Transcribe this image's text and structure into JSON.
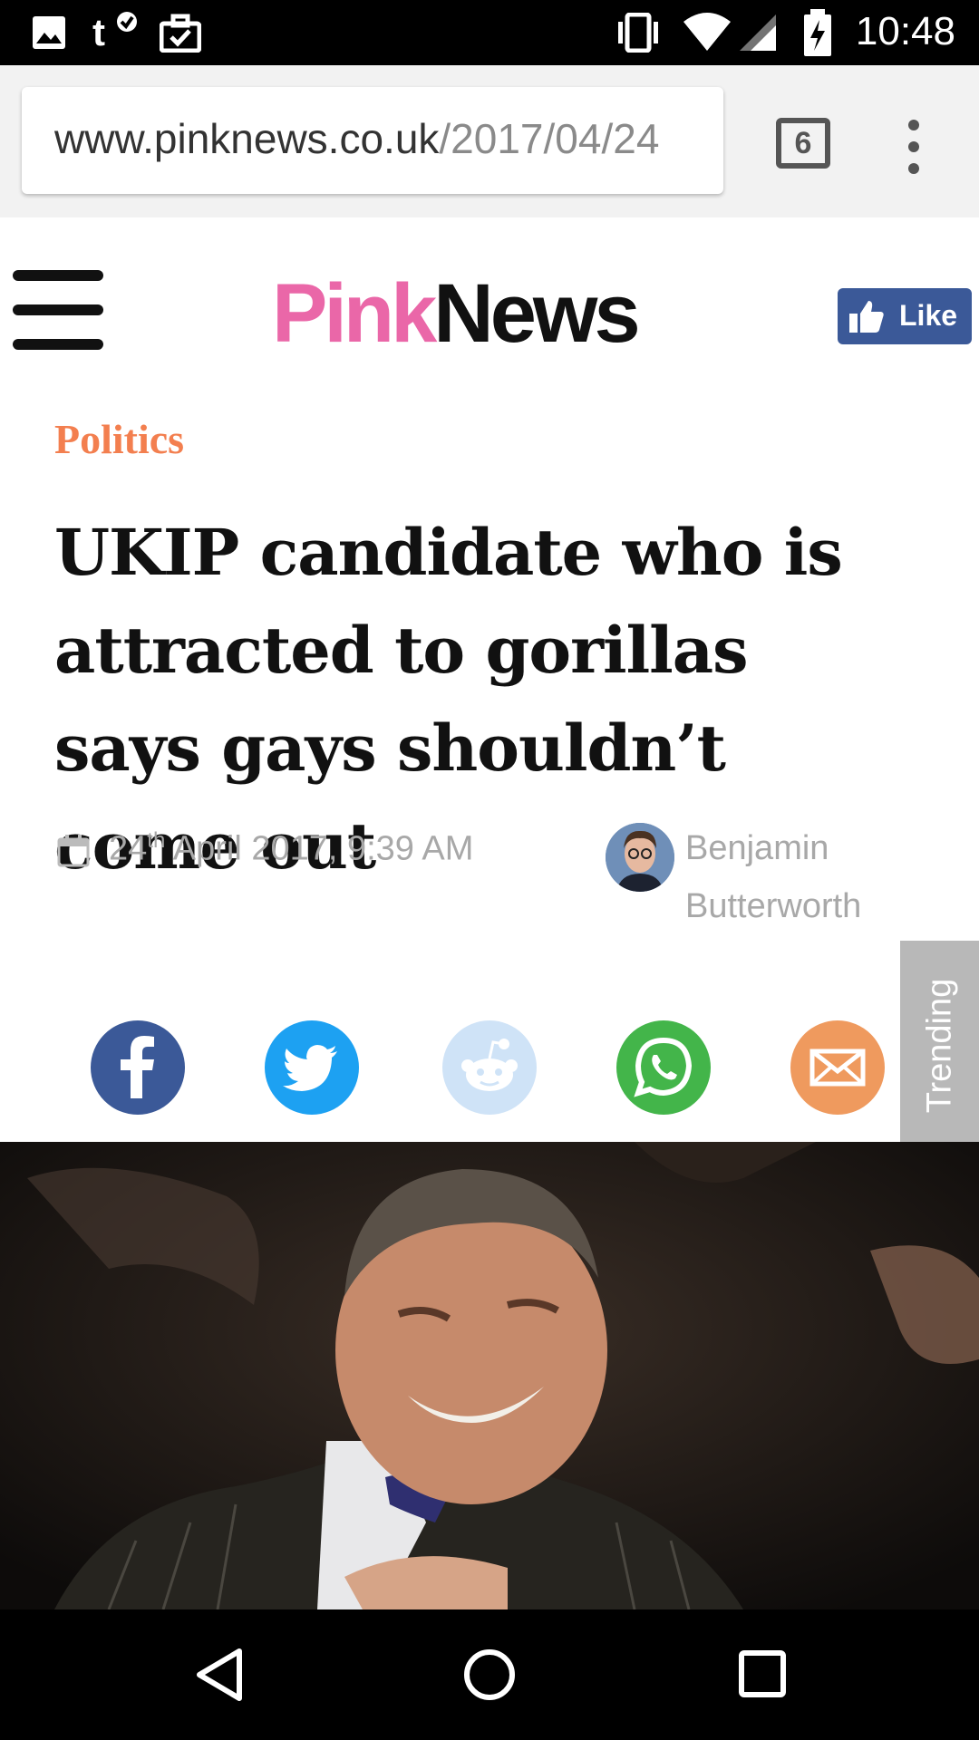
{
  "status_bar": {
    "time": "10:48",
    "icons": [
      "image-icon",
      "t-mobile-icon",
      "briefcase-check-icon",
      "vibrate-icon",
      "wifi-icon",
      "signal-icon",
      "battery-charging-icon"
    ]
  },
  "browser": {
    "url_domain": "www.pinknews.co.uk",
    "url_path": "/2017/04/24",
    "tab_count": "6"
  },
  "site": {
    "logo_pink": "Pink",
    "logo_news": "News",
    "like_label": "Like",
    "colors": {
      "pink": "#ea67a8",
      "facebook": "#3b5998",
      "category": "#f37f4f"
    }
  },
  "article": {
    "category": "Politics",
    "headline": "UKIP candidate who is attracted to gorillas says gays shouldn’t come out",
    "date_day": "24",
    "date_suffix": "th",
    "date_rest": " April 2017, 9:39 AM",
    "author_first": "Benjamin",
    "author_last": "Butterworth"
  },
  "share": [
    "facebook",
    "twitter",
    "reddit",
    "whatsapp",
    "email"
  ],
  "trending_label": "Trending"
}
